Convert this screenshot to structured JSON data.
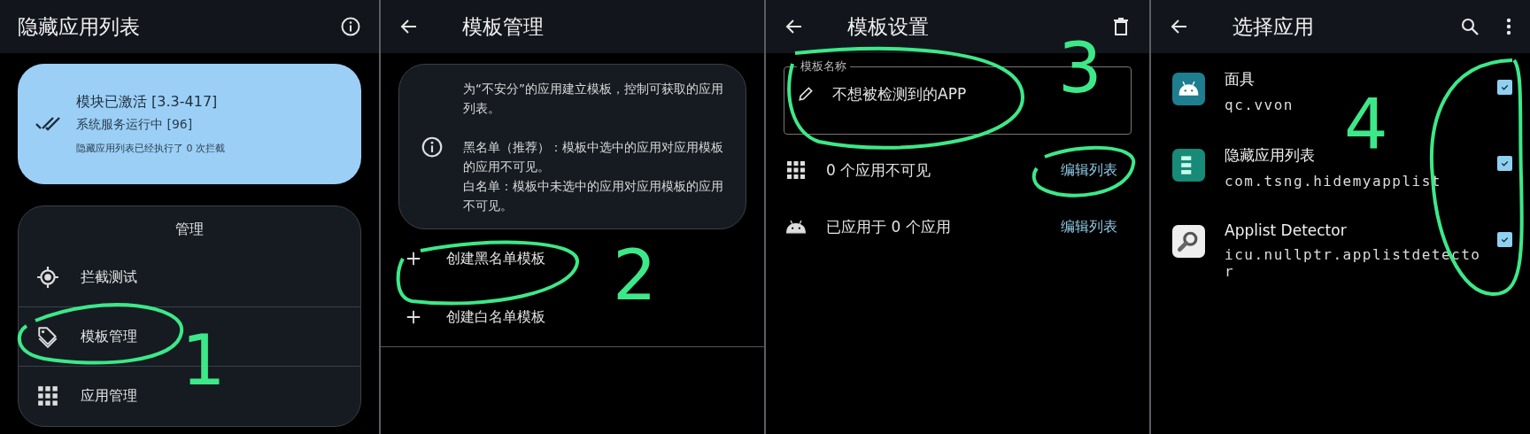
{
  "home": {
    "title": "隐藏应用列表",
    "status": {
      "title": "模块已激活 [3.3-417]",
      "service": "系统服务运行中 [96]",
      "note": "隐藏应用列表已经执行了 0 次拦截"
    },
    "manage": {
      "heading": "管理",
      "items": [
        {
          "kind": "target",
          "label": "拦截测试"
        },
        {
          "kind": "tag",
          "label": "模板管理"
        },
        {
          "kind": "grid",
          "label": "应用管理"
        }
      ]
    },
    "annotation": {
      "number": "1"
    }
  },
  "templates": {
    "title": "模板管理",
    "info": {
      "intro": "为“不安分”的应用建立模板，控制可获取的应用列表。",
      "blacklist": "黑名单（推荐）：模板中选中的应用对应用模板的应用不可见。",
      "whitelist": "白名单：模板中未选中的应用对应用模板的应用不可见。"
    },
    "actions": [
      {
        "label": "创建黑名单模板"
      },
      {
        "label": "创建白名单模板"
      }
    ],
    "annotation": {
      "number": "2"
    }
  },
  "template_settings": {
    "title": "模板设置",
    "name_field": {
      "label": "模板名称",
      "value": "不想被检测到的APP"
    },
    "rows": [
      {
        "kind": "grid",
        "text": "0 个应用不可见",
        "link": "编辑列表"
      },
      {
        "kind": "android",
        "text": "已应用于 0 个应用",
        "link": "编辑列表"
      }
    ],
    "annotation": {
      "number": "3"
    }
  },
  "select_apps": {
    "title": "选择应用",
    "apps": [
      {
        "kind": "android",
        "name": "面具",
        "package": "qc.vvon",
        "checked": true
      },
      {
        "kind": "list",
        "name": "隐藏应用列表",
        "package": "com.tsng.hidemyapplist",
        "checked": true
      },
      {
        "kind": "magnifier",
        "name": "Applist Detector",
        "package": "icu.nullptr.applistdetector",
        "checked": true
      }
    ],
    "annotation": {
      "number": "4"
    }
  }
}
